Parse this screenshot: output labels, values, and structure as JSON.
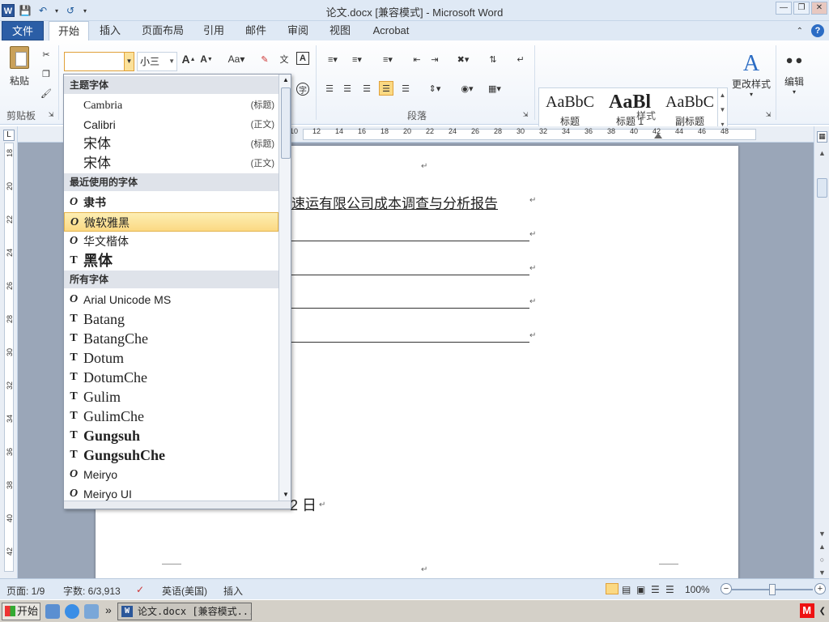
{
  "window": {
    "title": "论文.docx [兼容模式] - Microsoft Word",
    "app_icon": "W"
  },
  "tabs": [
    {
      "label": "文件",
      "kind": "file"
    },
    {
      "label": "开始",
      "kind": "active"
    },
    {
      "label": "插入"
    },
    {
      "label": "页面布局"
    },
    {
      "label": "引用"
    },
    {
      "label": "邮件"
    },
    {
      "label": "审阅"
    },
    {
      "label": "视图"
    },
    {
      "label": "Acrobat"
    }
  ],
  "ribbon": {
    "clipboard": {
      "paste_label": "粘贴",
      "group_label": "剪贴板"
    },
    "font": {
      "current_font": "",
      "current_size": "小三",
      "grow": "A",
      "shrink": "A",
      "case": "Aa",
      "group_label": ""
    },
    "paragraph": {
      "group_label": "段落"
    },
    "styles": {
      "group_label": "样式",
      "items": [
        {
          "sample": "AaBbC",
          "name": "标题"
        },
        {
          "sample": "AaBl",
          "name": "标题 1"
        },
        {
          "sample": "AaBbC",
          "name": "副标题"
        }
      ],
      "change_styles_label": "更改样式"
    },
    "editing": {
      "label": "编辑"
    }
  },
  "font_dropdown": {
    "sections": [
      {
        "title": "主题字体"
      },
      {
        "title": "最近使用的字体"
      },
      {
        "title": "所有字体"
      }
    ],
    "theme_fonts": [
      {
        "name": "Cambria",
        "tag": "(标题)"
      },
      {
        "name": "Calibri",
        "tag": "(正文)"
      },
      {
        "name": "宋体",
        "tag": "(标题)"
      },
      {
        "name": "宋体",
        "tag": "(正文)"
      }
    ],
    "recent_fonts": [
      {
        "name": "隶书",
        "icon": "O"
      },
      {
        "name": "微软雅黑",
        "icon": "O",
        "highlighted": true
      },
      {
        "name": "华文楷体",
        "icon": "O"
      },
      {
        "name": "黑体",
        "icon": "T"
      }
    ],
    "all_fonts": [
      {
        "name": "Arial Unicode MS",
        "icon": "O"
      },
      {
        "name": "Batang",
        "icon": "T"
      },
      {
        "name": "BatangChe",
        "icon": "T"
      },
      {
        "name": "Dotum",
        "icon": "T"
      },
      {
        "name": "DotumChe",
        "icon": "T"
      },
      {
        "name": "Gulim",
        "icon": "T"
      },
      {
        "name": "GulimChe",
        "icon": "T"
      },
      {
        "name": "Gungsuh",
        "icon": "T"
      },
      {
        "name": "GungsuhChe",
        "icon": "T"
      },
      {
        "name": "Meiryo",
        "icon": "O"
      },
      {
        "name": "Meiryo UI",
        "icon": "O"
      }
    ]
  },
  "document": {
    "title_fragment": "速运有限公司成本调查与分析报告",
    "date_fragment": "2 日",
    "para_mark": "↵"
  },
  "ruler": {
    "h_ticks": [
      "10",
      "12",
      "14",
      "16",
      "18",
      "20",
      "22",
      "24",
      "26",
      "28",
      "30",
      "32",
      "34",
      "36",
      "38",
      "40",
      "42",
      "44",
      "46",
      "48"
    ],
    "v_ticks": [
      "18",
      "20",
      "22",
      "24",
      "26",
      "28",
      "30",
      "32",
      "34",
      "36",
      "38",
      "40",
      "42"
    ]
  },
  "status": {
    "page": "页面: 1/9",
    "words": "字数: 6/3,913",
    "language": "英语(美国)",
    "mode": "插入",
    "zoom": "100%",
    "zoom_fraction": 0.5
  },
  "taskbar": {
    "start": "开始",
    "task_label": "论文.docx [兼容模式...",
    "chevron": "»"
  },
  "colors": {
    "accent": "#2b579a",
    "file_tab": "#2b5ea6",
    "highlight": "#fbd983"
  }
}
